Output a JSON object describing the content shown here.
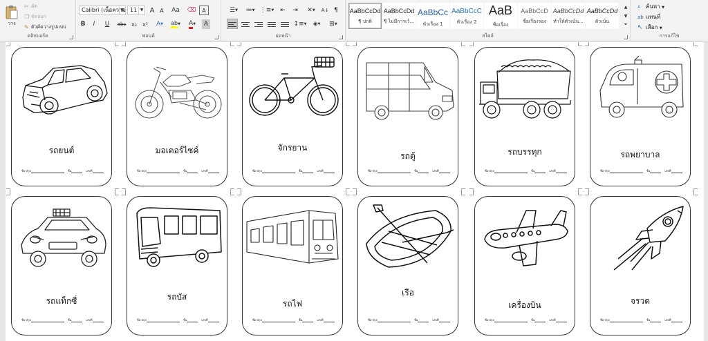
{
  "ribbon": {
    "clipboard": {
      "paste_label": "วาง",
      "cut_label": "ตัด",
      "copy_label": "คัดลอก",
      "format_painter_label": "ตัวคัดวางรูปแบบ",
      "group_label": "คลิปบอร์ด"
    },
    "font": {
      "font_name": "Calibri (เนื้อความ",
      "font_size": "11",
      "grow_label": "A",
      "shrink_label": "A",
      "case_label": "Aa",
      "bold_label": "B",
      "italic_label": "I",
      "underline_label": "U",
      "strike_label": "abc",
      "subscript_label": "x₂",
      "superscript_label": "x²",
      "effects_label": "A",
      "highlight_label": "ab",
      "color_label": "A",
      "shade_label": "A",
      "group_label": "ฟอนต์"
    },
    "paragraph": {
      "group_label": "ย่อหน้า",
      "sort_label": "A↓",
      "pilcrow_label": "¶"
    },
    "styles": {
      "group_label": "สไตล์",
      "items": [
        {
          "sample": "AaBbCcDd",
          "name": "¶ ปกติ"
        },
        {
          "sample": "AaBbCcDd",
          "name": "¶ ไม่มีการเว้..."
        },
        {
          "sample": "AaBbCc",
          "name": "หัวเรื่อง 1"
        },
        {
          "sample": "AaBbCcC",
          "name": "หัวเรื่อง 2"
        },
        {
          "sample": "AaB",
          "name": "ชื่อเรื่อง"
        },
        {
          "sample": "AaBbCcD",
          "name": "ชื่อเรื่องรอง"
        },
        {
          "sample": "AaBbCcDd",
          "name": "ทำให้ตัวเน้น..."
        },
        {
          "sample": "AaBbCcDd",
          "name": "ตัวเน้น"
        }
      ]
    },
    "editing": {
      "find_label": "ค้นหา",
      "replace_label": "แทนที่",
      "select_label": "เลือก",
      "group_label": "การแก้ไข"
    },
    "colors": {
      "find_icon": "#2a5fa8",
      "highlight": "#ffff00",
      "font_color": "#e02020"
    }
  },
  "document": {
    "footer": {
      "name_label": "ชื่อ-สกุล",
      "class_label": "ชั้น",
      "number_label": "เลขที่"
    },
    "cards": [
      {
        "word": "รถยนต์",
        "icon": "car-icon"
      },
      {
        "word": "มอเตอร์ไซค์",
        "icon": "motorcycle-icon"
      },
      {
        "word": "จักรยาน",
        "icon": "bicycle-icon"
      },
      {
        "word": "รถตู้",
        "icon": "van-icon"
      },
      {
        "word": "รถบรรทุก",
        "icon": "truck-icon"
      },
      {
        "word": "รถพยาบาล",
        "icon": "ambulance-icon"
      },
      {
        "word": "รถแท็กซี่",
        "icon": "taxi-icon"
      },
      {
        "word": "รถบัส",
        "icon": "bus-icon"
      },
      {
        "word": "รถไฟ",
        "icon": "train-icon"
      },
      {
        "word": "เรือ",
        "icon": "boat-icon"
      },
      {
        "word": "เครื่องบิน",
        "icon": "airplane-icon"
      },
      {
        "word": "จรวด",
        "icon": "rocket-icon"
      }
    ]
  }
}
